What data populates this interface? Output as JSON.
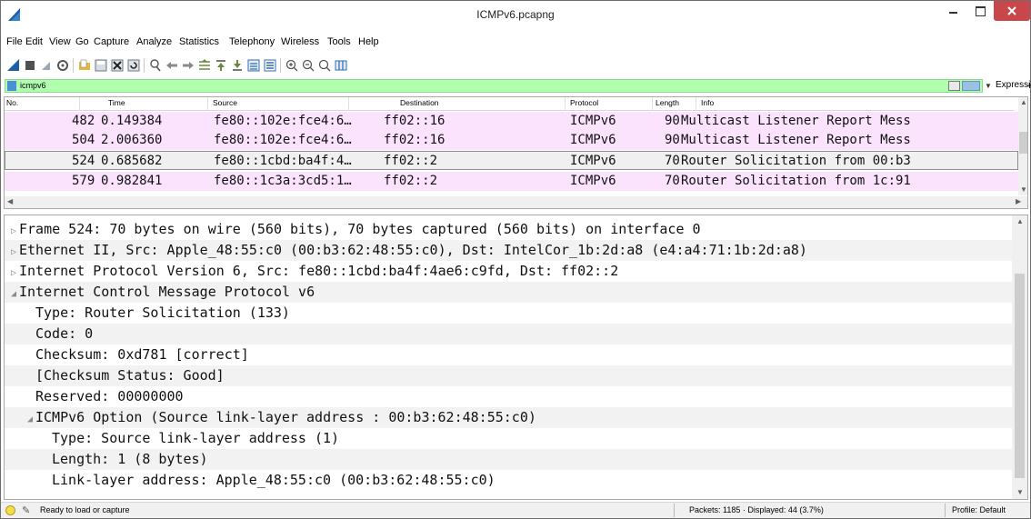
{
  "window": {
    "title": "ICMPv6.pcapng"
  },
  "menu": [
    "File",
    "Edit",
    "View",
    "Go",
    "Capture",
    "Analyze",
    "Statistics",
    "Telephony",
    "Wireless",
    "Tools",
    "Help"
  ],
  "filter": {
    "value": "icmpv6",
    "expression_label": "Expression...",
    "add_label": "+"
  },
  "packet_list": {
    "columns": [
      "No.",
      "Time",
      "Source",
      "Destination",
      "Protocol",
      "Length",
      "Info"
    ],
    "rows": [
      {
        "no": "482",
        "time": "0.149384",
        "source": "fe80::102e:fce4:6…",
        "destination": "ff02::16",
        "protocol": "ICMPv6",
        "length": "90",
        "info": "Multicast Listener Report Mess"
      },
      {
        "no": "504",
        "time": "2.006360",
        "source": "fe80::102e:fce4:6…",
        "destination": "ff02::16",
        "protocol": "ICMPv6",
        "length": "90",
        "info": "Multicast Listener Report Mess"
      },
      {
        "no": "524",
        "time": "0.685682",
        "source": "fe80::1cbd:ba4f:4…",
        "destination": "ff02::2",
        "protocol": "ICMPv6",
        "length": "70",
        "info": "Router Solicitation from 00:b3"
      },
      {
        "no": "579",
        "time": "0.982841",
        "source": "fe80::1c3a:3cd5:1…",
        "destination": "ff02::2",
        "protocol": "ICMPv6",
        "length": "70",
        "info": "Router Solicitation from 1c:91"
      }
    ]
  },
  "details": {
    "lines": [
      {
        "indent": 0,
        "expander": "▷",
        "text": "Frame 524: 70 bytes on wire (560 bits), 70 bytes captured (560 bits) on interface 0"
      },
      {
        "indent": 0,
        "expander": "▷",
        "text": "Ethernet II, Src: Apple_48:55:c0 (00:b3:62:48:55:c0), Dst: IntelCor_1b:2d:a8 (e4:a4:71:1b:2d:a8)"
      },
      {
        "indent": 0,
        "expander": "▷",
        "text": "Internet Protocol Version 6, Src: fe80::1cbd:ba4f:4ae6:c9fd, Dst: ff02::2"
      },
      {
        "indent": 0,
        "expander": "◢",
        "text": "Internet Control Message Protocol v6"
      },
      {
        "indent": 1,
        "expander": "",
        "text": "Type: Router Solicitation (133)"
      },
      {
        "indent": 1,
        "expander": "",
        "text": "Code: 0"
      },
      {
        "indent": 1,
        "expander": "",
        "text": "Checksum: 0xd781 [correct]"
      },
      {
        "indent": 1,
        "expander": "",
        "text": "[Checksum Status: Good]"
      },
      {
        "indent": 1,
        "expander": "",
        "text": "Reserved: 00000000"
      },
      {
        "indent": 1,
        "expander": "◢",
        "text": "ICMPv6 Option (Source link-layer address : 00:b3:62:48:55:c0)"
      },
      {
        "indent": 2,
        "expander": "",
        "text": "Type: Source link-layer address (1)"
      },
      {
        "indent": 2,
        "expander": "",
        "text": "Length: 1 (8 bytes)"
      },
      {
        "indent": 2,
        "expander": "",
        "text": "Link-layer address: Apple_48:55:c0 (00:b3:62:48:55:c0)"
      }
    ]
  },
  "status": {
    "ready": "Ready to load or capture",
    "packets": "Packets: 1185 · Displayed: 44 (3.7%)",
    "profile": "Profile: Default"
  },
  "colors": {
    "filter_valid": "#afffaf",
    "row_icmp": "#fbe3fe",
    "close_button": "#c7474a",
    "shark_fin": "#1f5fa8"
  },
  "icons": [
    "shark-fin-icon",
    "stop-icon",
    "restart-icon",
    "options-icon",
    "open-file-icon",
    "save-icon",
    "close-file-icon",
    "reload-icon",
    "find-icon",
    "back-icon",
    "forward-icon",
    "go-to-icon",
    "first-icon",
    "last-icon",
    "autoscroll-icon",
    "colorize-icon",
    "zoom-in-icon",
    "zoom-out-icon",
    "normal-size-icon",
    "resize-columns-icon"
  ]
}
